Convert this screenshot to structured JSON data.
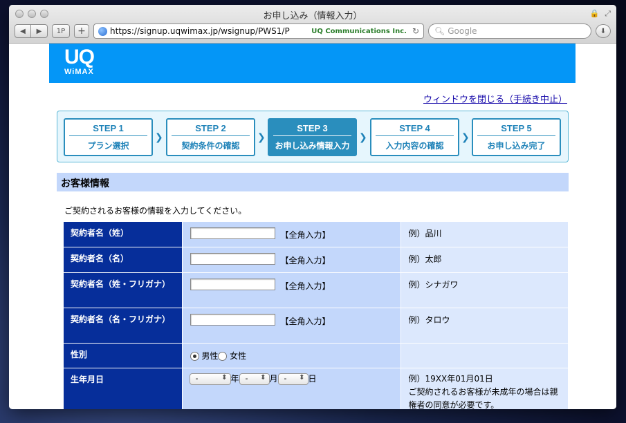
{
  "browser": {
    "title": "お申し込み（情報入力）",
    "url": "https://signup.uqwimax.jp/wsignup/PWS1/P",
    "cert": "UQ Communications Inc.",
    "search_placeholder": "Google",
    "topsites_label": "1P"
  },
  "header": {
    "logo_uq": "UQ",
    "logo_wimax": "WiMAX"
  },
  "close_link": "ウィンドウを閉じる（手続き中止）",
  "steps": [
    {
      "num": "STEP 1",
      "label": "プラン選択"
    },
    {
      "num": "STEP 2",
      "label": "契約条件の確認"
    },
    {
      "num": "STEP 3",
      "label": "お申し込み情報入力"
    },
    {
      "num": "STEP 4",
      "label": "入力内容の確認"
    },
    {
      "num": "STEP 5",
      "label": "お申し込み完了"
    }
  ],
  "section": {
    "title": "お客様情報",
    "intro": "ご契約されるお客様の情報を入力してください。"
  },
  "form": {
    "rows": [
      {
        "label": "契約者名（姓）",
        "hint": "【全角入力】",
        "example": "例）品川"
      },
      {
        "label": "契約者名（名）",
        "hint": "【全角入力】",
        "example": "例）太郎"
      },
      {
        "label": "契約者名（姓・フリガナ）",
        "hint": "【全角入力】",
        "example": "例）シナガワ"
      },
      {
        "label": "契約者名（名・フリガナ）",
        "hint": "【全角入力】",
        "example": "例）タロウ"
      }
    ],
    "gender": {
      "label": "性別",
      "male": "男性",
      "female": "女性"
    },
    "birth": {
      "label": "生年月日",
      "select_value": "-",
      "year": "年",
      "month": "月",
      "day": "日",
      "example": "例）19XX年01月01日",
      "note": "ご契約されるお客様が未成年の場合は親権者の同意が必要です。"
    }
  }
}
